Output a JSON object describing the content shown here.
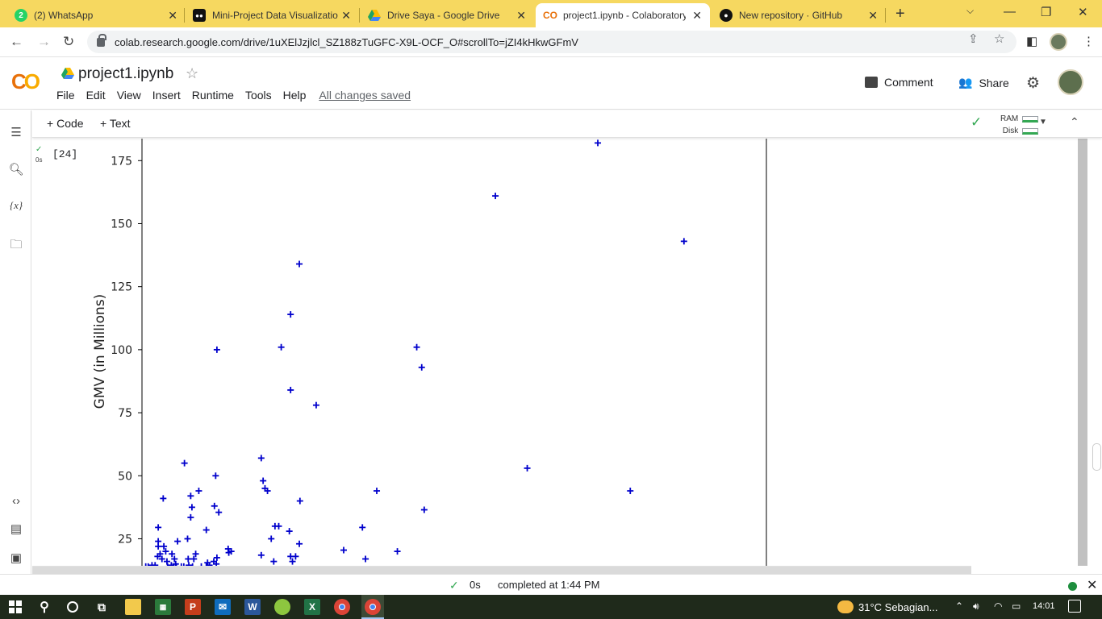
{
  "browser": {
    "tabs": [
      {
        "title": "(2) WhatsApp",
        "favicon": "whatsapp-icon",
        "badge": "2"
      },
      {
        "title": "Mini-Project Data Visualizatio",
        "favicon": "video-icon"
      },
      {
        "title": "Drive Saya - Google Drive",
        "favicon": "google-drive-icon"
      },
      {
        "title": "project1.ipynb - Colaboratory",
        "favicon": "colab-icon",
        "active": true
      },
      {
        "title": "New repository · GitHub",
        "favicon": "github-icon"
      }
    ],
    "url": "colab.research.google.com/drive/1uXElJzjlcl_SZ188zTuGFC-X9L-OCF_O#scrollTo=jZI4kHkwGFmV",
    "tab_bar_color": "#f6d860"
  },
  "colab": {
    "notebook_title": "project1.ipynb",
    "menu": [
      "File",
      "Edit",
      "View",
      "Insert",
      "Runtime",
      "Tools",
      "Help"
    ],
    "save_status": "All changes saved",
    "comment_label": "Comment",
    "share_label": "Share",
    "add_code": "Code",
    "add_text": "Text",
    "ram_label": "RAM",
    "disk_label": "Disk",
    "cell": {
      "exec_count": "[24]",
      "exec_time": "0s"
    }
  },
  "status": {
    "duration": "0s",
    "message": "completed at 1:44 PM"
  },
  "taskbar": {
    "weather": "31°C  Sebagian...",
    "time": "14:01"
  },
  "chart_data": {
    "type": "scatter",
    "marker": "+",
    "color": "#0000cc",
    "ylabel": "GMV (in Millions)",
    "ylim": [
      13,
      185
    ],
    "xlim": [
      0,
      100
    ],
    "yticks": [
      25,
      50,
      75,
      100,
      125,
      150,
      175
    ],
    "points": [
      [
        73,
        182
      ],
      [
        56.6,
        161
      ],
      [
        86.8,
        143
      ],
      [
        25.2,
        134
      ],
      [
        23.8,
        114
      ],
      [
        22.3,
        101
      ],
      [
        44,
        101
      ],
      [
        12,
        100
      ],
      [
        44.8,
        93
      ],
      [
        23.8,
        84
      ],
      [
        27.9,
        78
      ],
      [
        19.1,
        57
      ],
      [
        6.8,
        55
      ],
      [
        61.7,
        53
      ],
      [
        11.8,
        50
      ],
      [
        19.4,
        48
      ],
      [
        19.7,
        45
      ],
      [
        20.1,
        44
      ],
      [
        3.4,
        41
      ],
      [
        7.8,
        42
      ],
      [
        9.1,
        44
      ],
      [
        25.3,
        40
      ],
      [
        37.6,
        44
      ],
      [
        78.2,
        44
      ],
      [
        45.2,
        36.5
      ],
      [
        8,
        37.5
      ],
      [
        12.3,
        35.5
      ],
      [
        7.8,
        33.5
      ],
      [
        11.6,
        38
      ],
      [
        2.6,
        29.5
      ],
      [
        21.3,
        30
      ],
      [
        21.9,
        30
      ],
      [
        35.3,
        29.5
      ],
      [
        10.3,
        28.5
      ],
      [
        23.6,
        28
      ],
      [
        2.6,
        24
      ],
      [
        7.3,
        25
      ],
      [
        5.7,
        24
      ],
      [
        20.7,
        25
      ],
      [
        25.2,
        23
      ],
      [
        2.6,
        22
      ],
      [
        3.5,
        22
      ],
      [
        3.8,
        20
      ],
      [
        4.8,
        19
      ],
      [
        2.9,
        19
      ],
      [
        8.6,
        19
      ],
      [
        8.3,
        17
      ],
      [
        12,
        17.5
      ],
      [
        13.8,
        21
      ],
      [
        13.9,
        19.5
      ],
      [
        14.3,
        20
      ],
      [
        19.1,
        18.5
      ],
      [
        5.2,
        17
      ],
      [
        4,
        16
      ],
      [
        5.4,
        15
      ],
      [
        7.4,
        17
      ],
      [
        10.5,
        15.5
      ],
      [
        11.5,
        16
      ],
      [
        2.5,
        18
      ],
      [
        3.2,
        17
      ],
      [
        23.8,
        18
      ],
      [
        24.1,
        16
      ],
      [
        24.6,
        18
      ],
      [
        32.3,
        20.5
      ],
      [
        35.8,
        17
      ],
      [
        40.9,
        20
      ],
      [
        21.1,
        16
      ],
      [
        1,
        14
      ],
      [
        1.6,
        14.5
      ],
      [
        2.1,
        14.5
      ],
      [
        4.1,
        14
      ],
      [
        5.5,
        14
      ],
      [
        6.3,
        14
      ],
      [
        7.5,
        14.5
      ],
      [
        8.1,
        14
      ],
      [
        9.5,
        14
      ],
      [
        10.3,
        14
      ],
      [
        10.8,
        14.5
      ],
      [
        11.9,
        15
      ],
      [
        0.6,
        14
      ],
      [
        4.7,
        14.5
      ],
      [
        6.7,
        14
      ]
    ]
  }
}
